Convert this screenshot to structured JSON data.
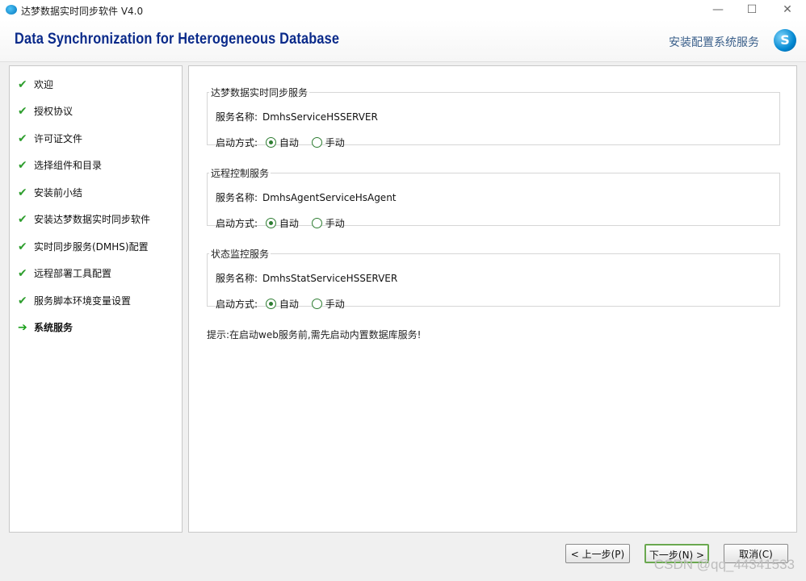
{
  "window": {
    "title": "达梦数据实时同步软件 V4.0",
    "minimize_glyph": "—",
    "maximize_glyph": "☐",
    "close_glyph": "✕"
  },
  "header": {
    "product_title": "Data Synchronization for Heterogeneous Database",
    "step_title": "安装配置系统服务",
    "logo_glyph": "S"
  },
  "sidebar": {
    "items": [
      {
        "label": "欢迎",
        "status": "done"
      },
      {
        "label": "授权协议",
        "status": "done"
      },
      {
        "label": "许可证文件",
        "status": "done"
      },
      {
        "label": "选择组件和目录",
        "status": "done"
      },
      {
        "label": "安装前小结",
        "status": "done"
      },
      {
        "label": "安装达梦数据实时同步软件",
        "status": "done"
      },
      {
        "label": "实时同步服务(DMHS)配置",
        "status": "done"
      },
      {
        "label": "远程部署工具配置",
        "status": "done"
      },
      {
        "label": "服务脚本环境变量设置",
        "status": "done"
      },
      {
        "label": "系统服务",
        "status": "current"
      }
    ],
    "done_glyph": "✔",
    "current_glyph": "➔"
  },
  "main": {
    "groups": [
      {
        "title": "达梦数据实时同步服务",
        "name_label": "服务名称:",
        "name_value": "DmhsServiceHSSERVER",
        "start_label": "启动方式:",
        "auto_label": "自动",
        "manual_label": "手动",
        "selected": "auto"
      },
      {
        "title": "远程控制服务",
        "name_label": "服务名称:",
        "name_value": "DmhsAgentServiceHsAgent",
        "start_label": "启动方式:",
        "auto_label": "自动",
        "manual_label": "手动",
        "selected": "auto"
      },
      {
        "title": "状态监控服务",
        "name_label": "服务名称:",
        "name_value": "DmhsStatServiceHSSERVER",
        "start_label": "启动方式:",
        "auto_label": "自动",
        "manual_label": "手动",
        "selected": "auto"
      }
    ],
    "hint": "提示:在启动web服务前,需先启动内置数据库服务!"
  },
  "footer": {
    "prev_label": "< 上一步(P)",
    "next_label": "下一步(N) >",
    "cancel_label": "取消(C)"
  },
  "watermark": "CSDN @qq_44341533",
  "colors": {
    "title_blue": "#0a2a8a",
    "check_green": "#2e9e2e",
    "radio_green": "#2e7d32"
  }
}
